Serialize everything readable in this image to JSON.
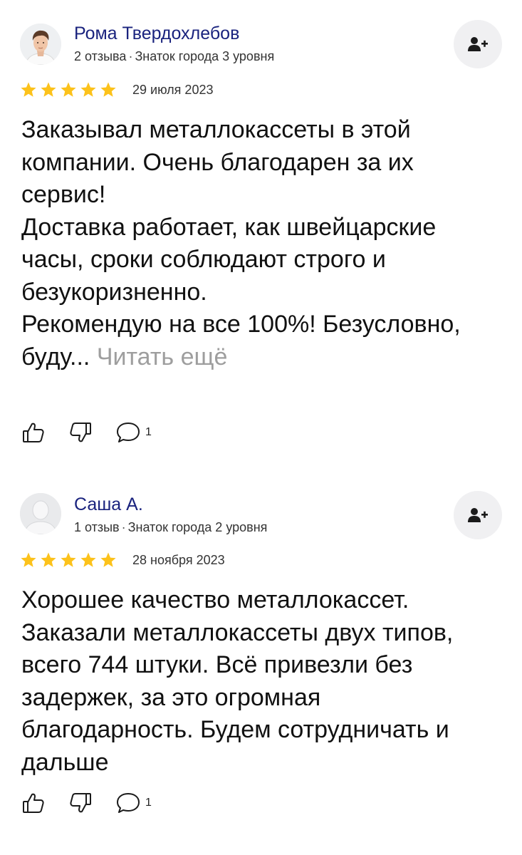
{
  "reviews": [
    {
      "author_name": "Рома Твердохлебов",
      "reviews_count": "2 отзыва",
      "separator": "·",
      "level": "Знаток города 3 уровня",
      "rating": 5,
      "date": "29 июля 2023",
      "text": "Заказывал металлокассеты в этой компании. Очень благодарен за их сервис!\nДоставка работает, как швейцарские часы, сроки соблюдают строго и безукоризненно.\nРекомендую на все 100%! Безусловно, буду...",
      "read_more": "Читать ещё",
      "comments_count": "1",
      "avatar_icon": "user-photo-icon"
    },
    {
      "author_name": "Саша А.",
      "reviews_count": "1 отзыв",
      "separator": "·",
      "level": "Знаток города 2 уровня",
      "rating": 5,
      "date": "28 ноября 2023",
      "text": "Хорошее качество металлокассет. Заказали металлокассеты двух типов, всего 744 штуки. Всё привезли без задержек, за это огромная благодарность. Будем сотрудничать и дальше",
      "comments_count": "1",
      "avatar_icon": "default-avatar-icon"
    }
  ],
  "colors": {
    "author": "#1a237e",
    "star": "#fcc21b",
    "read_more": "#9e9e9e",
    "subscribe_bg": "#f0f0f2"
  },
  "icons": {
    "subscribe": "add-user-icon",
    "like": "thumbs-up-icon",
    "dislike": "thumbs-down-icon",
    "comment": "comment-bubble-icon",
    "star": "star-icon"
  }
}
